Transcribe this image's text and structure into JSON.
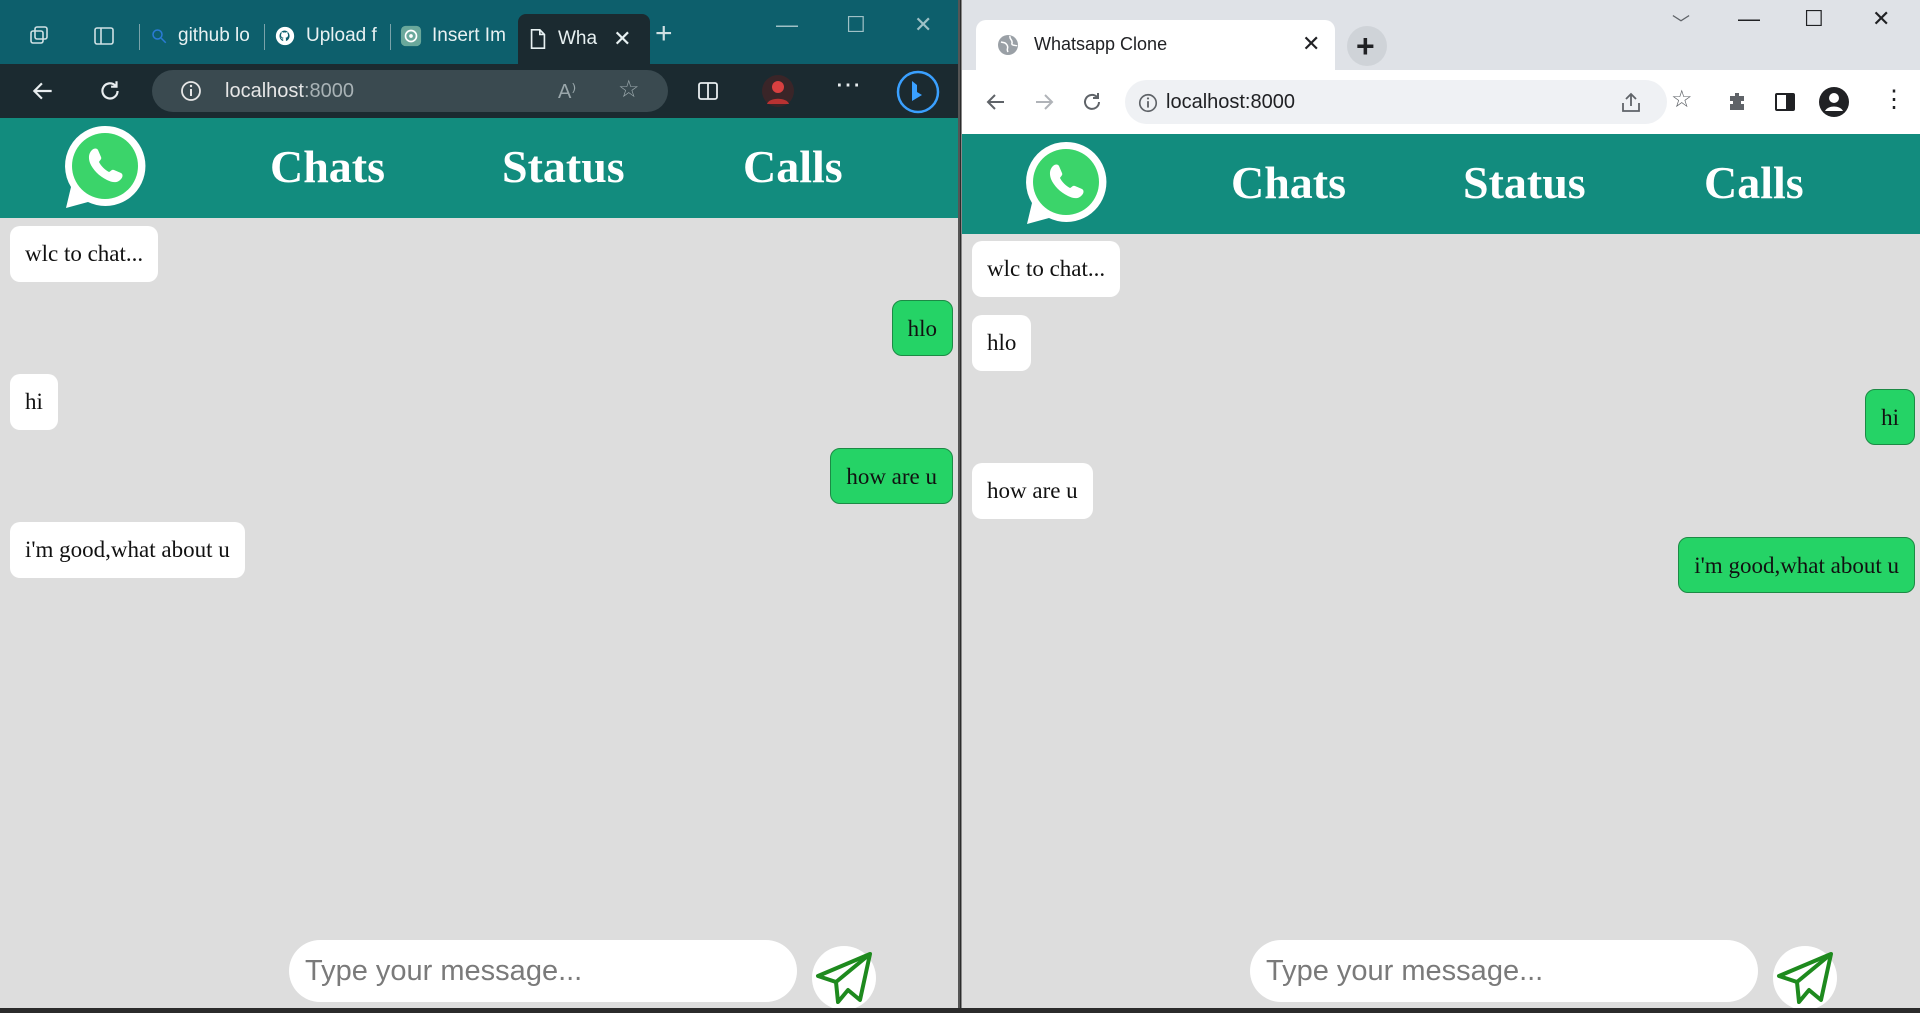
{
  "edge": {
    "tabs": [
      {
        "label": "github lo"
      },
      {
        "label": "Upload f"
      },
      {
        "label": "Insert Im"
      },
      {
        "label": "Wha"
      }
    ],
    "address": {
      "host": "localhost",
      "port": ":8000"
    }
  },
  "chrome": {
    "tab_title": "Whatsapp Clone",
    "address": "localhost:8000"
  },
  "app": {
    "nav": {
      "chats": "Chats",
      "status": "Status",
      "calls": "Calls"
    },
    "input_placeholder": "Type your message...",
    "colors": {
      "header": "#128c7e",
      "sent": "#25d366",
      "received": "#ffffff",
      "background": "#dddddd"
    }
  },
  "left_messages": [
    {
      "text": "wlc to chat...",
      "side": "received"
    },
    {
      "text": "hlo",
      "side": "sent"
    },
    {
      "text": "hi",
      "side": "received"
    },
    {
      "text": "how are u",
      "side": "sent"
    },
    {
      "text": "i'm good,what about u",
      "side": "received"
    }
  ],
  "right_messages": [
    {
      "text": "wlc to chat...",
      "side": "received"
    },
    {
      "text": "hlo",
      "side": "received"
    },
    {
      "text": "hi",
      "side": "sent"
    },
    {
      "text": "how are u",
      "side": "received"
    },
    {
      "text": "i'm good,what about u",
      "side": "sent"
    }
  ]
}
